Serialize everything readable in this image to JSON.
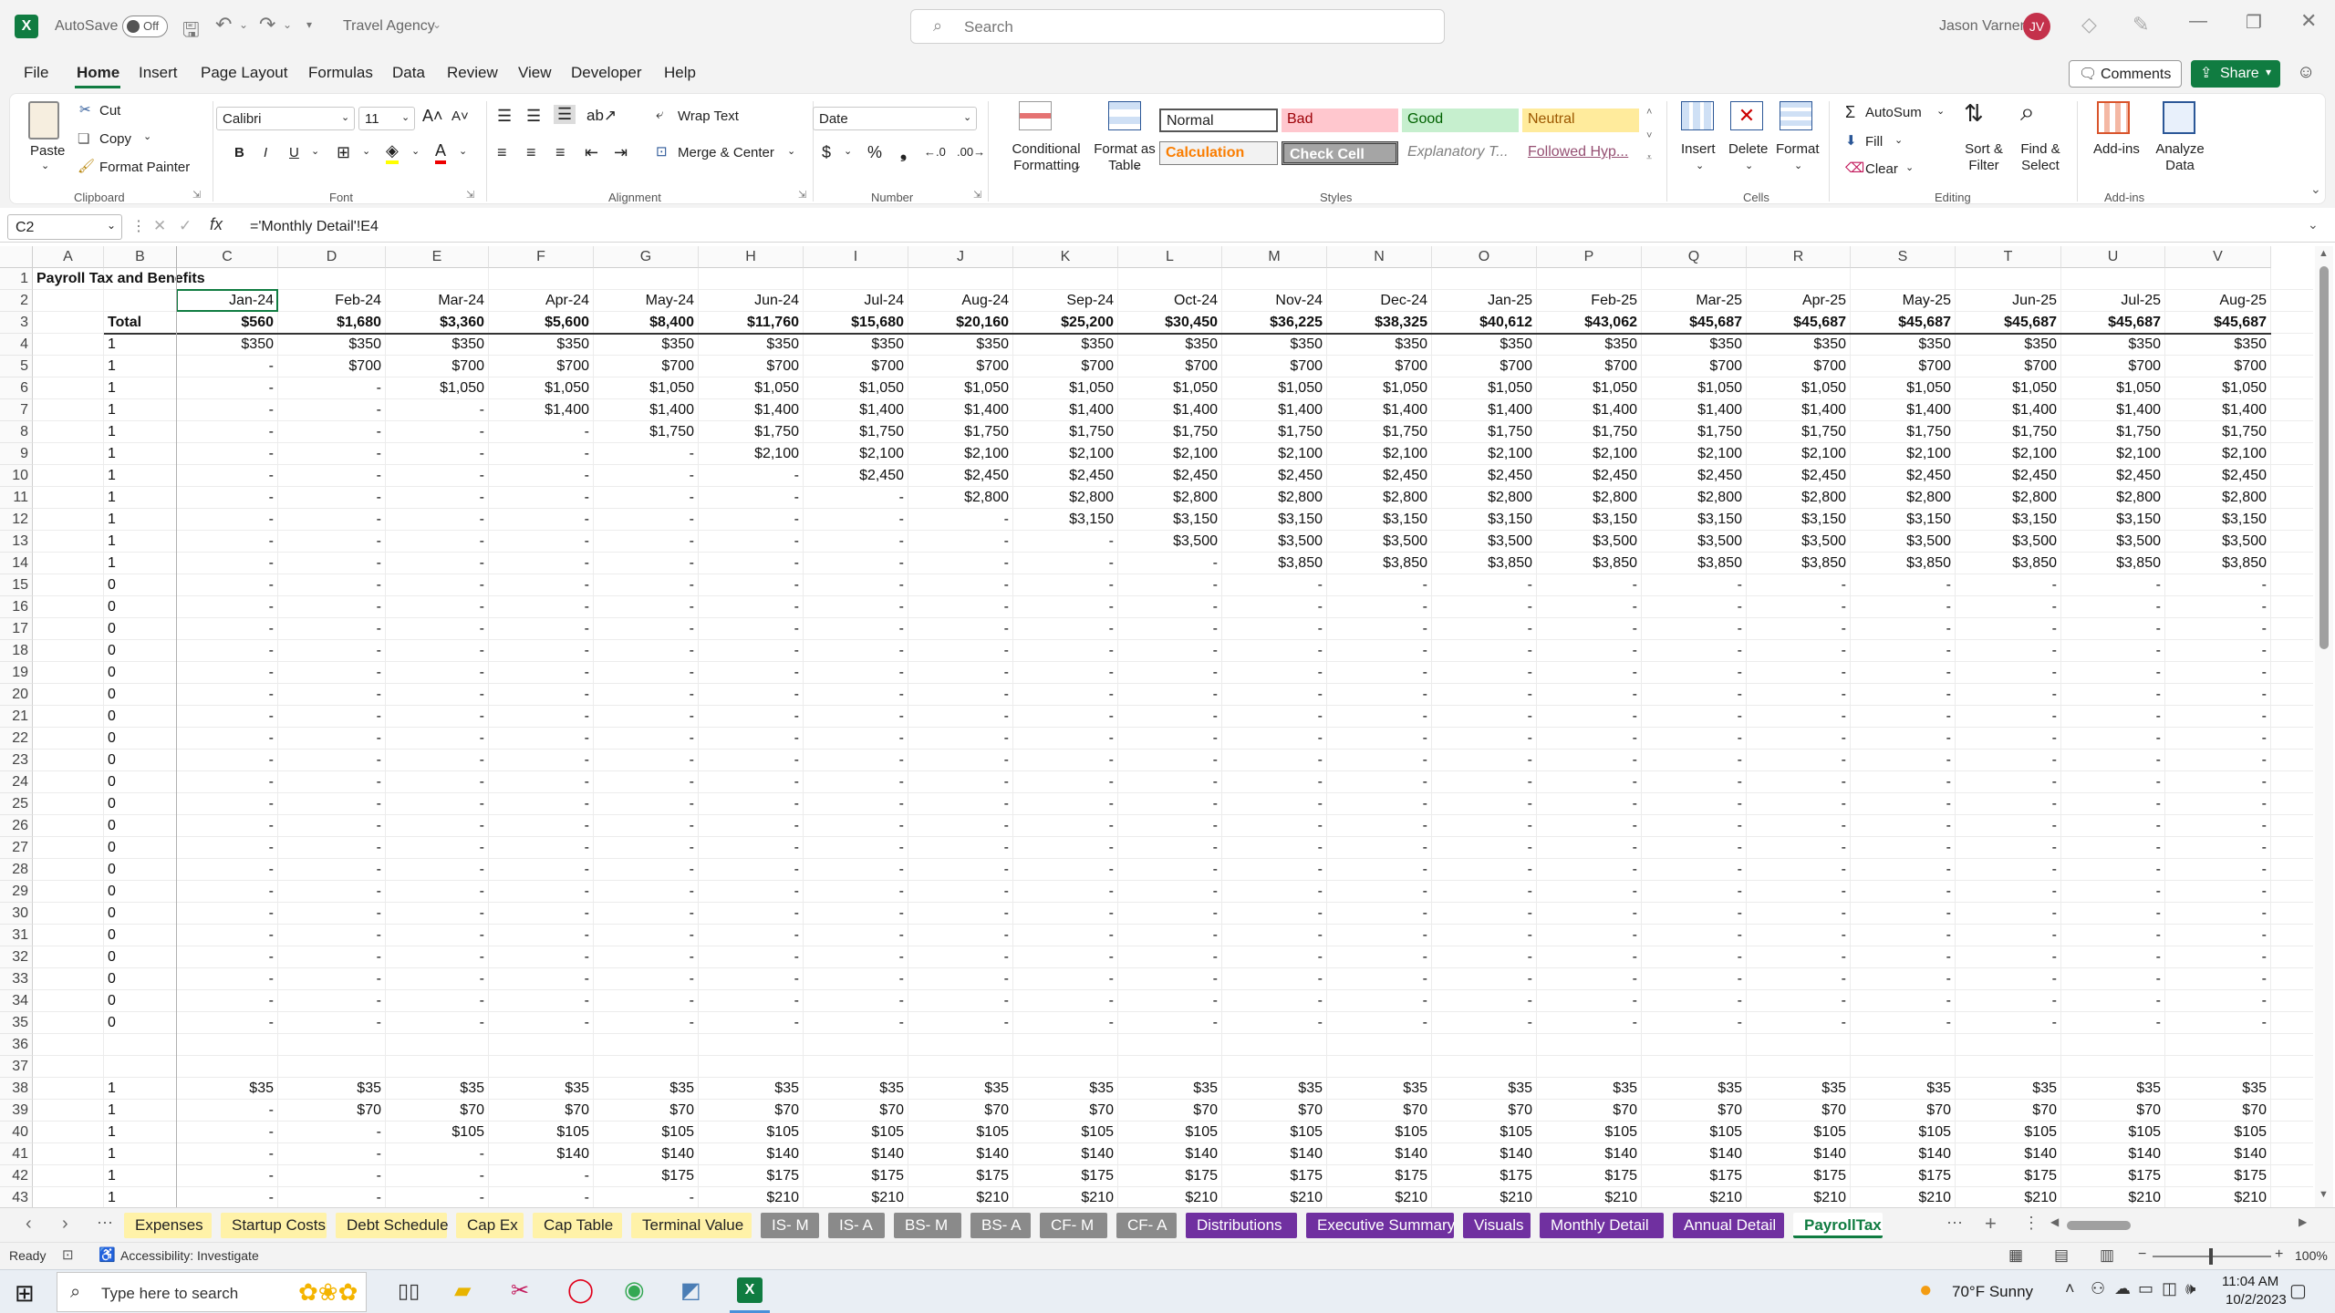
{
  "titlebar": {
    "autosave_label": "AutoSave",
    "autosave_state": "Off",
    "workbook_name": "Travel Agency",
    "search_placeholder": "Search",
    "user_name": "Jason Varner",
    "user_initials": "JV"
  },
  "menu": [
    "File",
    "Home",
    "Insert",
    "Page Layout",
    "Formulas",
    "Data",
    "Review",
    "View",
    "Developer",
    "Help"
  ],
  "menu_active": "Home",
  "comments_label": "Comments",
  "share_label": "Share",
  "ribbon": {
    "clipboard": {
      "paste": "Paste",
      "cut": "Cut",
      "copy": "Copy",
      "format_painter": "Format Painter",
      "group": "Clipboard"
    },
    "font": {
      "name": "Calibri",
      "size": "11",
      "group": "Font"
    },
    "alignment": {
      "wrap": "Wrap Text",
      "merge": "Merge & Center",
      "group": "Alignment"
    },
    "number": {
      "format": "Date",
      "group": "Number"
    },
    "styles": {
      "conditional": "Conditional Formatting",
      "format_table": "Format as Table",
      "normal": "Normal",
      "bad": "Bad",
      "good": "Good",
      "neutral": "Neutral",
      "calculation": "Calculation",
      "check_cell": "Check Cell",
      "explanatory": "Explanatory T...",
      "followed": "Followed Hyp...",
      "group": "Styles"
    },
    "cells": {
      "insert": "Insert",
      "delete": "Delete",
      "format": "Format",
      "group": "Cells"
    },
    "editing": {
      "autosum": "AutoSum",
      "fill": "Fill",
      "clear": "Clear",
      "sort": "Sort & Filter",
      "find": "Find & Select",
      "group": "Editing"
    },
    "addins": {
      "addins": "Add-ins",
      "analyze": "Analyze Data",
      "group": "Add-ins"
    }
  },
  "formula_bar": {
    "name_box": "C2",
    "formula": "='Monthly Detail'!E4"
  },
  "grid": {
    "columns": [
      "A",
      "B",
      "C",
      "D",
      "E",
      "F",
      "G",
      "H",
      "I",
      "J",
      "K",
      "L",
      "M",
      "N",
      "O",
      "P",
      "Q",
      "R",
      "S",
      "T",
      "U",
      "V"
    ],
    "months": [
      "Jan-24",
      "Feb-24",
      "Mar-24",
      "Apr-24",
      "May-24",
      "Jun-24",
      "Jul-24",
      "Aug-24",
      "Sep-24",
      "Oct-24",
      "Nov-24",
      "Dec-24",
      "Jan-25",
      "Feb-25",
      "Mar-25",
      "Apr-25",
      "May-25",
      "Jun-25",
      "Jul-25",
      "Aug-25"
    ],
    "title": "Payroll Tax and Benefits",
    "total_label": "Total",
    "totals": [
      "$560",
      "$1,680",
      "$3,360",
      "$5,600",
      "$8,400",
      "$11,760",
      "$15,680",
      "$20,160",
      "$25,200",
      "$30,450",
      "$36,225",
      "$38,325",
      "$40,612",
      "$43,062",
      "$45,687",
      "$45,687",
      "$45,687",
      "$45,687",
      "$45,687",
      "$45,687"
    ],
    "emp_rows": [
      {
        "flag": "1",
        "start": 0,
        "value": "$350"
      },
      {
        "flag": "1",
        "start": 1,
        "value": "$700"
      },
      {
        "flag": "1",
        "start": 2,
        "value": "$1,050"
      },
      {
        "flag": "1",
        "start": 3,
        "value": "$1,400"
      },
      {
        "flag": "1",
        "start": 4,
        "value": "$1,750"
      },
      {
        "flag": "1",
        "start": 5,
        "value": "$2,100"
      },
      {
        "flag": "1",
        "start": 6,
        "value": "$2,450"
      },
      {
        "flag": "1",
        "start": 7,
        "value": "$2,800"
      },
      {
        "flag": "1",
        "start": 8,
        "value": "$3,150"
      },
      {
        "flag": "1",
        "start": 9,
        "value": "$3,500"
      },
      {
        "flag": "1",
        "start": 10,
        "value": "$3,850"
      }
    ],
    "zero_rows_count": 21,
    "benefit_rows": [
      {
        "flag": "1",
        "start": 0,
        "value": "$35"
      },
      {
        "flag": "1",
        "start": 1,
        "value": "$70"
      },
      {
        "flag": "1",
        "start": 2,
        "value": "$105"
      },
      {
        "flag": "1",
        "start": 3,
        "value": "$140"
      },
      {
        "flag": "1",
        "start": 4,
        "value": "$175"
      },
      {
        "flag": "1",
        "start": 5,
        "value": "$210"
      }
    ],
    "dash": "-",
    "zero": "0"
  },
  "sheet_tabs": [
    {
      "name": "Expenses",
      "color": "#fff2a8",
      "text": "#222"
    },
    {
      "name": "Startup Costs",
      "color": "#fff2a8",
      "text": "#222"
    },
    {
      "name": "Debt Schedule",
      "color": "#fff2a8",
      "text": "#222"
    },
    {
      "name": "Cap Ex",
      "color": "#fff2a8",
      "text": "#222"
    },
    {
      "name": "Cap Table",
      "color": "#fff2a8",
      "text": "#222"
    },
    {
      "name": "Terminal Value",
      "color": "#fff2a8",
      "text": "#222"
    },
    {
      "name": "IS- M",
      "color": "#8a8a8a",
      "text": "#ffffff"
    },
    {
      "name": "IS- A",
      "color": "#8a8a8a",
      "text": "#ffffff"
    },
    {
      "name": "BS- M",
      "color": "#8a8a8a",
      "text": "#ffffff"
    },
    {
      "name": "BS- A",
      "color": "#8a8a8a",
      "text": "#ffffff"
    },
    {
      "name": "CF- M",
      "color": "#8a8a8a",
      "text": "#ffffff"
    },
    {
      "name": "CF- A",
      "color": "#8a8a8a",
      "text": "#ffffff"
    },
    {
      "name": "Distributions",
      "color": "#7030a0",
      "text": "#ffffff"
    },
    {
      "name": "Executive Summary",
      "color": "#7030a0",
      "text": "#ffffff"
    },
    {
      "name": "Visuals",
      "color": "#7030a0",
      "text": "#ffffff"
    },
    {
      "name": "Monthly Detail",
      "color": "#7030a0",
      "text": "#ffffff"
    },
    {
      "name": "Annual Detail",
      "color": "#7030a0",
      "text": "#ffffff"
    },
    {
      "name": "PayrollTax",
      "color": "#ffffff",
      "text": "#107c41"
    }
  ],
  "status": {
    "ready": "Ready",
    "accessibility": "Accessibility: Investigate",
    "zoom": "100%"
  },
  "taskbar": {
    "search_placeholder": "Type here to search",
    "weather": "70°F  Sunny",
    "time": "11:04 AM",
    "date": "10/2/2023"
  },
  "colors": {
    "excel_green": "#107c41",
    "avatar": "#c4314b"
  }
}
